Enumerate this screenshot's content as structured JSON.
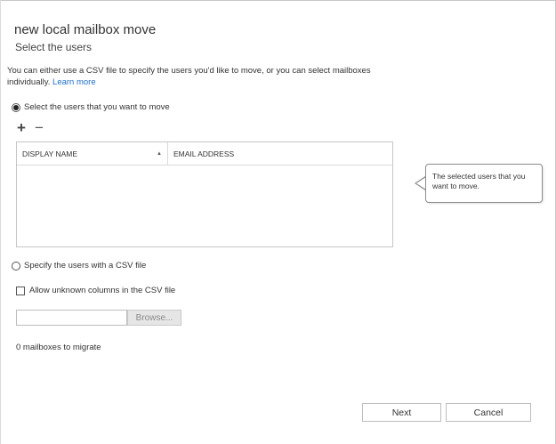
{
  "wizard": {
    "title": "new local mailbox move",
    "subtitle": "Select the users"
  },
  "intro": {
    "text": "You can either use a CSV file to specify the users you'd like to move, or you can select mailboxes individually.",
    "link": "Learn more"
  },
  "options": {
    "select_users": {
      "label": "Select the users that you want to move",
      "checked": true
    },
    "csv_file": {
      "label": "Specify the users with a CSV file",
      "checked": false
    }
  },
  "toolbar": {
    "add_glyph": "+",
    "remove_glyph": "−"
  },
  "grid": {
    "columns": [
      "DISPLAY NAME",
      "EMAIL ADDRESS"
    ],
    "sort_glyph": "▲",
    "rows": []
  },
  "callout": {
    "text": "The selected users that you want to move."
  },
  "csv": {
    "allow_unknown_label": "Allow unknown columns in the CSV file",
    "allow_unknown_checked": false,
    "file_value": "",
    "browse_label": "Browse..."
  },
  "status": {
    "count_text": "0 mailboxes to migrate"
  },
  "footer": {
    "next_label": "Next",
    "cancel_label": "Cancel"
  }
}
